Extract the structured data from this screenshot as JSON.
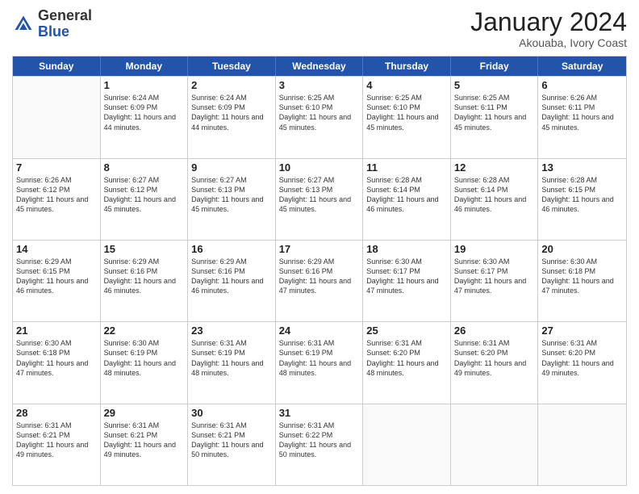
{
  "header": {
    "logo_general": "General",
    "logo_blue": "Blue",
    "month_title": "January 2024",
    "location": "Akouaba, Ivory Coast"
  },
  "weekdays": [
    "Sunday",
    "Monday",
    "Tuesday",
    "Wednesday",
    "Thursday",
    "Friday",
    "Saturday"
  ],
  "weeks": [
    [
      {
        "day": "",
        "empty": true
      },
      {
        "day": "1",
        "sunrise": "6:24 AM",
        "sunset": "6:09 PM",
        "daylight": "11 hours and 44 minutes."
      },
      {
        "day": "2",
        "sunrise": "6:24 AM",
        "sunset": "6:09 PM",
        "daylight": "11 hours and 44 minutes."
      },
      {
        "day": "3",
        "sunrise": "6:25 AM",
        "sunset": "6:10 PM",
        "daylight": "11 hours and 45 minutes."
      },
      {
        "day": "4",
        "sunrise": "6:25 AM",
        "sunset": "6:10 PM",
        "daylight": "11 hours and 45 minutes."
      },
      {
        "day": "5",
        "sunrise": "6:25 AM",
        "sunset": "6:11 PM",
        "daylight": "11 hours and 45 minutes."
      },
      {
        "day": "6",
        "sunrise": "6:26 AM",
        "sunset": "6:11 PM",
        "daylight": "11 hours and 45 minutes."
      }
    ],
    [
      {
        "day": "7",
        "sunrise": "6:26 AM",
        "sunset": "6:12 PM",
        "daylight": "11 hours and 45 minutes."
      },
      {
        "day": "8",
        "sunrise": "6:27 AM",
        "sunset": "6:12 PM",
        "daylight": "11 hours and 45 minutes."
      },
      {
        "day": "9",
        "sunrise": "6:27 AM",
        "sunset": "6:13 PM",
        "daylight": "11 hours and 45 minutes."
      },
      {
        "day": "10",
        "sunrise": "6:27 AM",
        "sunset": "6:13 PM",
        "daylight": "11 hours and 45 minutes."
      },
      {
        "day": "11",
        "sunrise": "6:28 AM",
        "sunset": "6:14 PM",
        "daylight": "11 hours and 46 minutes."
      },
      {
        "day": "12",
        "sunrise": "6:28 AM",
        "sunset": "6:14 PM",
        "daylight": "11 hours and 46 minutes."
      },
      {
        "day": "13",
        "sunrise": "6:28 AM",
        "sunset": "6:15 PM",
        "daylight": "11 hours and 46 minutes."
      }
    ],
    [
      {
        "day": "14",
        "sunrise": "6:29 AM",
        "sunset": "6:15 PM",
        "daylight": "11 hours and 46 minutes."
      },
      {
        "day": "15",
        "sunrise": "6:29 AM",
        "sunset": "6:16 PM",
        "daylight": "11 hours and 46 minutes."
      },
      {
        "day": "16",
        "sunrise": "6:29 AM",
        "sunset": "6:16 PM",
        "daylight": "11 hours and 46 minutes."
      },
      {
        "day": "17",
        "sunrise": "6:29 AM",
        "sunset": "6:16 PM",
        "daylight": "11 hours and 47 minutes."
      },
      {
        "day": "18",
        "sunrise": "6:30 AM",
        "sunset": "6:17 PM",
        "daylight": "11 hours and 47 minutes."
      },
      {
        "day": "19",
        "sunrise": "6:30 AM",
        "sunset": "6:17 PM",
        "daylight": "11 hours and 47 minutes."
      },
      {
        "day": "20",
        "sunrise": "6:30 AM",
        "sunset": "6:18 PM",
        "daylight": "11 hours and 47 minutes."
      }
    ],
    [
      {
        "day": "21",
        "sunrise": "6:30 AM",
        "sunset": "6:18 PM",
        "daylight": "11 hours and 47 minutes."
      },
      {
        "day": "22",
        "sunrise": "6:30 AM",
        "sunset": "6:19 PM",
        "daylight": "11 hours and 48 minutes."
      },
      {
        "day": "23",
        "sunrise": "6:31 AM",
        "sunset": "6:19 PM",
        "daylight": "11 hours and 48 minutes."
      },
      {
        "day": "24",
        "sunrise": "6:31 AM",
        "sunset": "6:19 PM",
        "daylight": "11 hours and 48 minutes."
      },
      {
        "day": "25",
        "sunrise": "6:31 AM",
        "sunset": "6:20 PM",
        "daylight": "11 hours and 48 minutes."
      },
      {
        "day": "26",
        "sunrise": "6:31 AM",
        "sunset": "6:20 PM",
        "daylight": "11 hours and 49 minutes."
      },
      {
        "day": "27",
        "sunrise": "6:31 AM",
        "sunset": "6:20 PM",
        "daylight": "11 hours and 49 minutes."
      }
    ],
    [
      {
        "day": "28",
        "sunrise": "6:31 AM",
        "sunset": "6:21 PM",
        "daylight": "11 hours and 49 minutes."
      },
      {
        "day": "29",
        "sunrise": "6:31 AM",
        "sunset": "6:21 PM",
        "daylight": "11 hours and 49 minutes."
      },
      {
        "day": "30",
        "sunrise": "6:31 AM",
        "sunset": "6:21 PM",
        "daylight": "11 hours and 50 minutes."
      },
      {
        "day": "31",
        "sunrise": "6:31 AM",
        "sunset": "6:22 PM",
        "daylight": "11 hours and 50 minutes."
      },
      {
        "day": "",
        "empty": true
      },
      {
        "day": "",
        "empty": true
      },
      {
        "day": "",
        "empty": true
      }
    ]
  ],
  "labels": {
    "sunrise": "Sunrise:",
    "sunset": "Sunset:",
    "daylight": "Daylight:"
  }
}
